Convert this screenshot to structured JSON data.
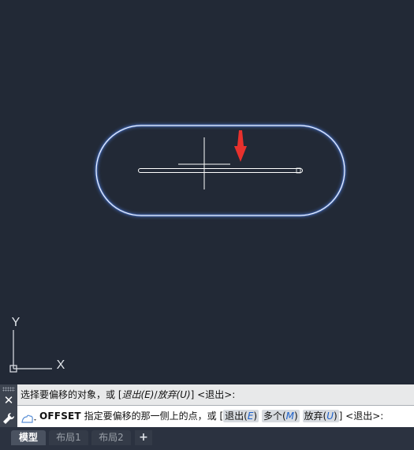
{
  "ucs": {
    "x_label": "X",
    "y_label": "Y"
  },
  "command": {
    "history": {
      "prompt": "选择要偏移的对象，或 ",
      "opt_open": "[",
      "opt_exit": "退出(E)",
      "opt_sep": "/",
      "opt_undo": "放弃(U)",
      "opt_close": "]",
      "default": " <退出>:"
    },
    "input": {
      "command_name": "OFFSET",
      "prompt": " 指定要偏移的那一侧上的点，或 [",
      "opt_exit_label": "退出(",
      "opt_exit_key": "E",
      "opt_exit_end": ")",
      "opt_multi_label": "多个(",
      "opt_multi_key": "M",
      "opt_multi_end": ")",
      "opt_undo_label": "放弃(",
      "opt_undo_key": "U",
      "opt_undo_end": ")",
      "close": "] ",
      "default": "<退出>:"
    }
  },
  "tabs": [
    {
      "label": "模型",
      "active": true
    },
    {
      "label": "布局1",
      "active": false
    },
    {
      "label": "布局2",
      "active": false
    }
  ],
  "tab_add_label": "+",
  "colors": {
    "canvas_bg": "#222936",
    "slot_outline": "#dfe9ff",
    "arrow": "#e8312d",
    "option_key": "#1b5fc9"
  }
}
